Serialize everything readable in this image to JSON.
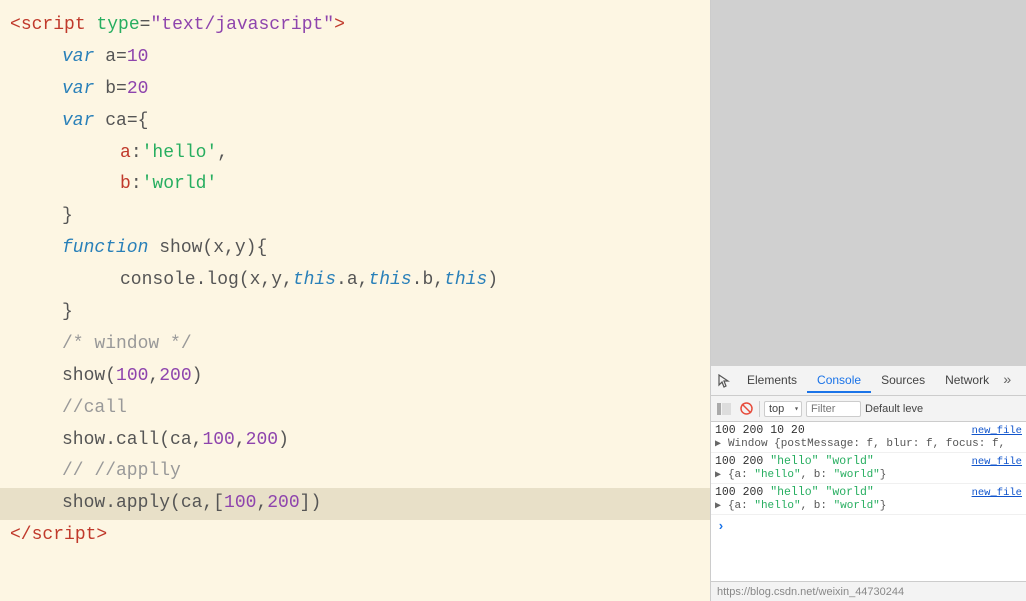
{
  "code": {
    "lines": [
      {
        "id": "line-script-open",
        "indent": 0,
        "highlighted": false,
        "parts": [
          {
            "text": "<",
            "cls": "tag"
          },
          {
            "text": "script",
            "cls": "tag"
          },
          {
            "text": " ",
            "cls": "plain"
          },
          {
            "text": "type",
            "cls": "attr-name"
          },
          {
            "text": "=",
            "cls": "plain"
          },
          {
            "text": "\"text/javascript\"",
            "cls": "attr-val"
          },
          {
            "text": ">",
            "cls": "tag"
          }
        ]
      },
      {
        "id": "line-var-a",
        "indent": 1,
        "highlighted": false,
        "parts": [
          {
            "text": "var",
            "cls": "kw-var"
          },
          {
            "text": " a",
            "cls": "plain"
          },
          {
            "text": "=",
            "cls": "plain"
          },
          {
            "text": "10",
            "cls": "num"
          }
        ]
      },
      {
        "id": "line-var-b",
        "indent": 1,
        "highlighted": false,
        "parts": [
          {
            "text": "var",
            "cls": "kw-var"
          },
          {
            "text": " b",
            "cls": "plain"
          },
          {
            "text": "=",
            "cls": "plain"
          },
          {
            "text": "20",
            "cls": "num"
          }
        ]
      },
      {
        "id": "line-var-ca",
        "indent": 1,
        "highlighted": false,
        "parts": [
          {
            "text": "var",
            "cls": "kw-var"
          },
          {
            "text": " ca",
            "cls": "plain"
          },
          {
            "text": "={",
            "cls": "plain"
          }
        ]
      },
      {
        "id": "line-ca-a",
        "indent": 2,
        "highlighted": false,
        "parts": [
          {
            "text": "a",
            "cls": "obj-key"
          },
          {
            "text": ":",
            "cls": "plain"
          },
          {
            "text": "'hello'",
            "cls": "str"
          },
          {
            "text": ",",
            "cls": "plain"
          }
        ]
      },
      {
        "id": "line-ca-b",
        "indent": 2,
        "highlighted": false,
        "parts": [
          {
            "text": "b",
            "cls": "obj-key"
          },
          {
            "text": ":",
            "cls": "plain"
          },
          {
            "text": "'world'",
            "cls": "str"
          }
        ]
      },
      {
        "id": "line-ca-close",
        "indent": 1,
        "highlighted": false,
        "parts": [
          {
            "text": "}",
            "cls": "plain"
          }
        ]
      },
      {
        "id": "line-func-def",
        "indent": 1,
        "highlighted": false,
        "parts": [
          {
            "text": "function",
            "cls": "kw-func"
          },
          {
            "text": " show(x,y){",
            "cls": "plain"
          }
        ]
      },
      {
        "id": "line-consolelog",
        "indent": 2,
        "highlighted": false,
        "parts": [
          {
            "text": "console.log(x,y,",
            "cls": "plain"
          },
          {
            "text": "this",
            "cls": "kw-var"
          },
          {
            "text": ".a,",
            "cls": "plain"
          },
          {
            "text": "this",
            "cls": "kw-var"
          },
          {
            "text": ".b,",
            "cls": "plain"
          },
          {
            "text": "this",
            "cls": "kw-var"
          },
          {
            "text": ")",
            "cls": "plain"
          }
        ]
      },
      {
        "id": "line-func-close",
        "indent": 1,
        "highlighted": false,
        "parts": [
          {
            "text": "}",
            "cls": "plain"
          }
        ]
      },
      {
        "id": "line-comment-window",
        "indent": 1,
        "highlighted": false,
        "parts": [
          {
            "text": "/* window */",
            "cls": "comment"
          }
        ]
      },
      {
        "id": "line-show-call",
        "indent": 1,
        "highlighted": false,
        "parts": [
          {
            "text": "show(",
            "cls": "plain"
          },
          {
            "text": "100",
            "cls": "num"
          },
          {
            "text": ",",
            "cls": "plain"
          },
          {
            "text": "200",
            "cls": "num"
          },
          {
            "text": ")",
            "cls": "plain"
          }
        ]
      },
      {
        "id": "line-comment-call",
        "indent": 1,
        "highlighted": false,
        "parts": [
          {
            "text": "//call",
            "cls": "comment"
          }
        ]
      },
      {
        "id": "line-show-callmethod",
        "indent": 1,
        "highlighted": false,
        "parts": [
          {
            "text": "show.call(ca,",
            "cls": "plain"
          },
          {
            "text": "100",
            "cls": "num"
          },
          {
            "text": ",",
            "cls": "plain"
          },
          {
            "text": "200",
            "cls": "num"
          },
          {
            "text": ")",
            "cls": "plain"
          }
        ]
      },
      {
        "id": "line-comment-apply",
        "indent": 1,
        "highlighted": false,
        "parts": [
          {
            "text": "// //applly",
            "cls": "comment"
          }
        ]
      },
      {
        "id": "line-show-apply",
        "indent": 1,
        "highlighted": true,
        "parts": [
          {
            "text": "show.apply(ca,[",
            "cls": "plain"
          },
          {
            "text": "100",
            "cls": "num"
          },
          {
            "text": ",",
            "cls": "plain"
          },
          {
            "text": "200",
            "cls": "num"
          },
          {
            "text": "])",
            "cls": "plain"
          }
        ]
      },
      {
        "id": "line-script-close",
        "indent": 0,
        "highlighted": false,
        "parts": [
          {
            "text": "</",
            "cls": "tag"
          },
          {
            "text": "script",
            "cls": "tag"
          },
          {
            "text": ">",
            "cls": "tag"
          }
        ]
      }
    ]
  },
  "devtools": {
    "tabs": [
      "Elements",
      "Console",
      "Sources",
      "Network"
    ],
    "active_tab": "Console",
    "more_label": "»",
    "inspect_icon": "⬚",
    "context": "top",
    "filter_placeholder": "Filter",
    "default_levels": "Default leve",
    "console_clear_icon": "🚫",
    "console_entries": [
      {
        "id": "entry-1",
        "value": "100 200 10 20",
        "link": "new_file",
        "expand": false,
        "expandText": "▶ Window {postMessage: f, blur: f, focus: f,"
      },
      {
        "id": "entry-2",
        "value": "100 200 \"hello\" \"world\"",
        "link": "new_file",
        "expand": false,
        "expandText": "▶ {a: \"hello\", b: \"world\"}"
      },
      {
        "id": "entry-3",
        "value": "100 200 \"hello\" \"world\"",
        "link": "new_file",
        "expand": false,
        "expandText": "▶ {a: \"hello\", b: \"world\"}"
      }
    ],
    "prompt_arrow": "›",
    "statusbar_url": "https://blog.csdn.net/weixin_44730244"
  }
}
